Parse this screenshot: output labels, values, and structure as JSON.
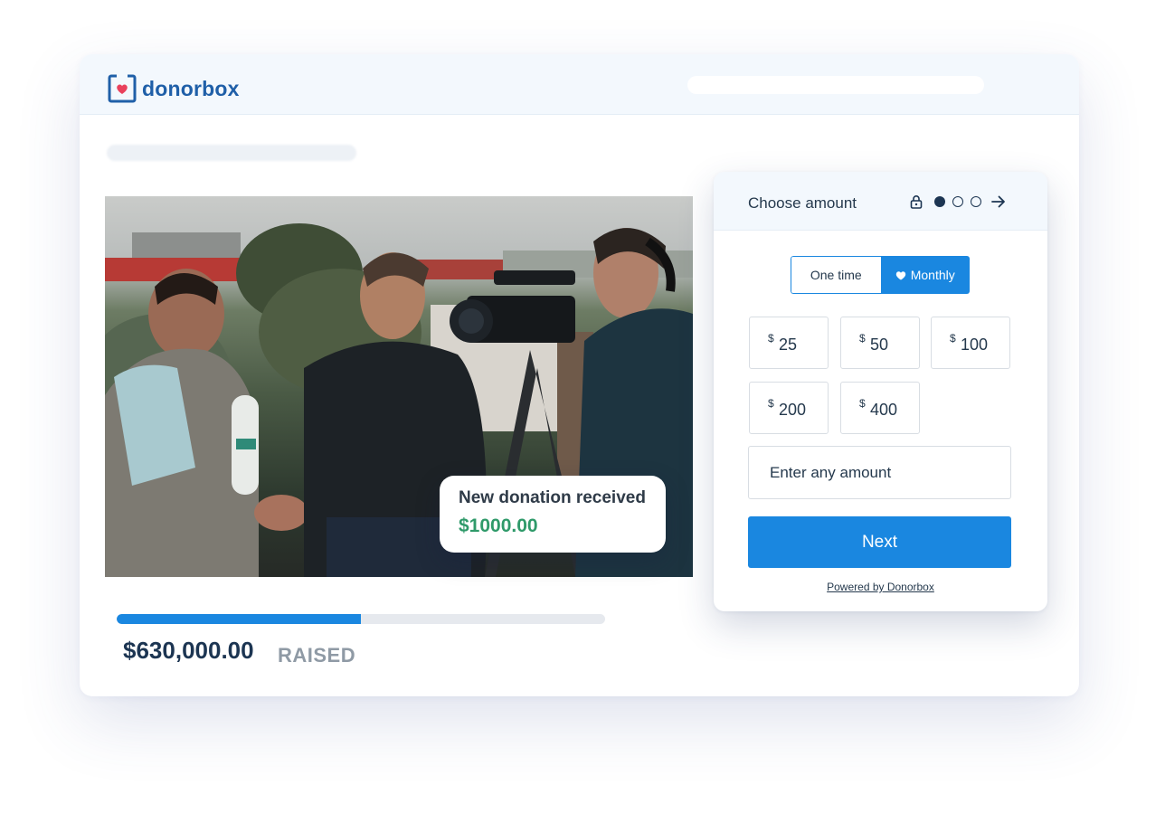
{
  "brand": {
    "name": "donorbox",
    "color": "#1f5fa8",
    "accent": "#e9415c",
    "logo_icon": "donorbox-logo-icon"
  },
  "toast": {
    "title": "New donation received",
    "amount": "$1000.00",
    "amount_color": "#2f9a6a"
  },
  "campaign": {
    "raised_amount": "$630,000.00",
    "raised_label": "RAISED",
    "progress_fraction": 0.5,
    "progress_color": "#1a87e0"
  },
  "widget": {
    "title": "Choose amount",
    "icons": [
      "lock-icon",
      "step-dot-active",
      "step-dot-inactive",
      "step-dot-inactive",
      "arrow-right-icon"
    ],
    "frequency": {
      "one_time_label": "One time",
      "monthly_label": "Monthly",
      "selected": "Monthly"
    },
    "currency_symbol": "$",
    "amounts": [
      "25",
      "50",
      "100",
      "200",
      "400"
    ],
    "custom_placeholder": "Enter any amount",
    "next_label": "Next",
    "powered_by": "Powered by Donorbox",
    "primary_color": "#1a87e0"
  }
}
